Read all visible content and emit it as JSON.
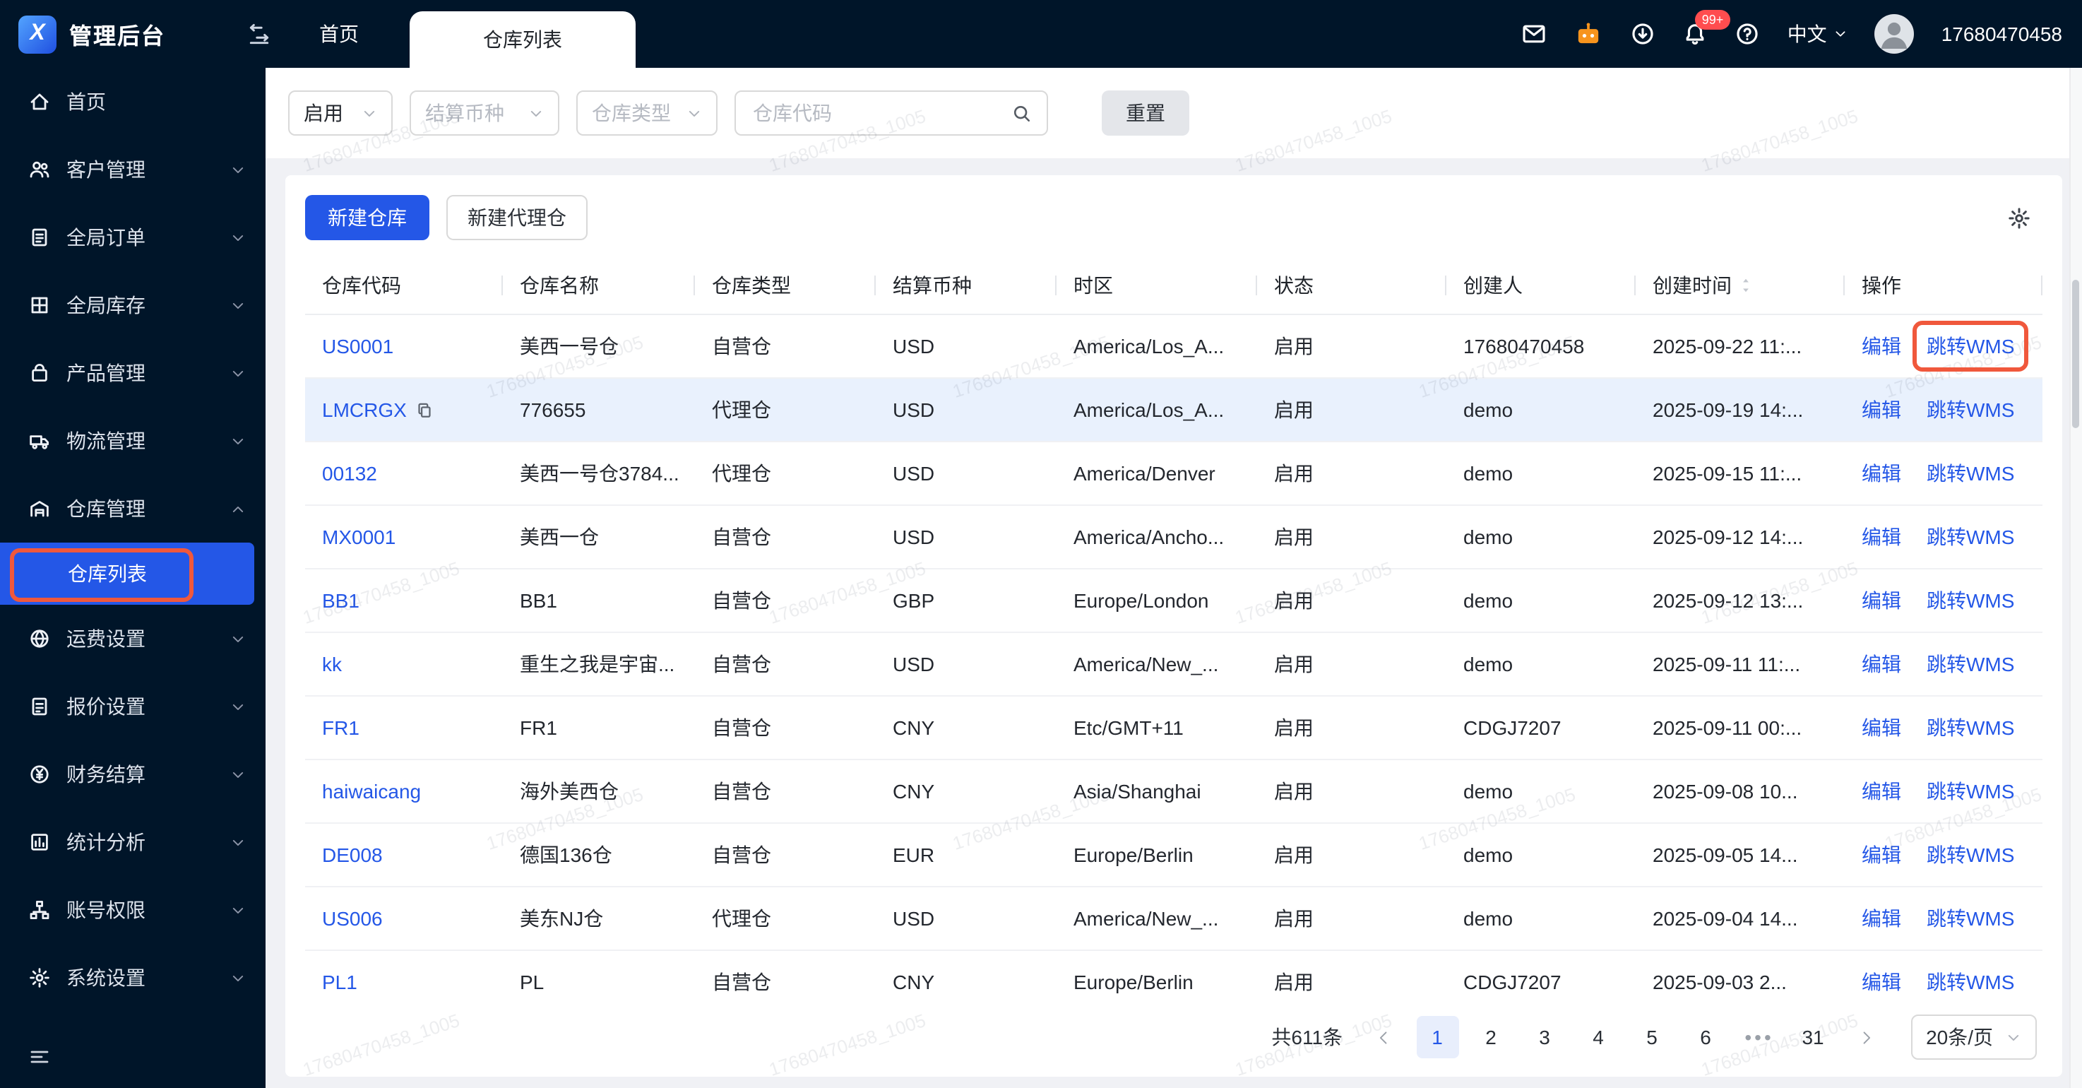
{
  "topbar": {
    "brand": "管理后台",
    "tabs": [
      {
        "key": "home",
        "label": "首页",
        "active": false
      },
      {
        "key": "warehouse-list",
        "label": "仓库列表",
        "active": true
      }
    ],
    "notification_badge": "99+",
    "language": "中文",
    "username": "17680470458"
  },
  "sidebar": {
    "items": [
      {
        "key": "home",
        "label": "首页",
        "icon": "home-icon"
      },
      {
        "key": "customer-management",
        "label": "客户管理",
        "icon": "customers-icon",
        "expandable": true
      },
      {
        "key": "global-orders",
        "label": "全局订单",
        "icon": "orders-icon",
        "expandable": true
      },
      {
        "key": "global-inventory",
        "label": "全局库存",
        "icon": "inventory-icon",
        "expandable": true
      },
      {
        "key": "product-management",
        "label": "产品管理",
        "icon": "product-icon",
        "expandable": true
      },
      {
        "key": "logistics-management",
        "label": "物流管理",
        "icon": "logistics-icon",
        "expandable": true
      },
      {
        "key": "warehouse-management",
        "label": "仓库管理",
        "icon": "warehouse-icon",
        "expandable": true,
        "expanded": true,
        "children": [
          {
            "key": "warehouse-list",
            "label": "仓库列表",
            "active": true,
            "annotated": true
          }
        ]
      },
      {
        "key": "freight-settings",
        "label": "运费设置",
        "icon": "freight-icon",
        "expandable": true
      },
      {
        "key": "quote-settings",
        "label": "报价设置",
        "icon": "quote-icon",
        "expandable": true
      },
      {
        "key": "finance-settlement",
        "label": "财务结算",
        "icon": "finance-icon",
        "expandable": true
      },
      {
        "key": "statistics-analysis",
        "label": "统计分析",
        "icon": "stats-icon",
        "expandable": true
      },
      {
        "key": "account-permissions",
        "label": "账号权限",
        "icon": "account-icon",
        "expandable": true
      },
      {
        "key": "system-settings",
        "label": "系统设置",
        "icon": "system-icon",
        "expandable": true
      }
    ]
  },
  "filters": {
    "status_value": "启用",
    "currency_placeholder": "结算币种",
    "type_placeholder": "仓库类型",
    "code_placeholder": "仓库代码",
    "reset_label": "重置"
  },
  "toolbar": {
    "new_warehouse_label": "新建仓库",
    "new_agent_warehouse_label": "新建代理仓"
  },
  "table": {
    "columns": [
      "仓库代码",
      "仓库名称",
      "仓库类型",
      "结算币种",
      "时区",
      "状态",
      "创建人",
      "创建时间",
      "操作"
    ],
    "action_labels": {
      "edit": "编辑",
      "jump_wms": "跳转WMS"
    },
    "rows": [
      {
        "code": "US0001",
        "name": "美西一号仓",
        "type": "自营仓",
        "currency": "USD",
        "tz": "America/Los_A...",
        "status": "启用",
        "creator": "17680470458",
        "created": "2025-09-22 11:...",
        "annotated": true
      },
      {
        "code": "LMCRGX",
        "copyable": true,
        "name": "776655",
        "type": "代理仓",
        "currency": "USD",
        "tz": "America/Los_A...",
        "status": "启用",
        "creator": "demo",
        "created": "2025-09-19 14:...",
        "highlight": true
      },
      {
        "code": "00132",
        "name": "美西一号仓3784...",
        "type": "代理仓",
        "currency": "USD",
        "tz": "America/Denver",
        "status": "启用",
        "creator": "demo",
        "created": "2025-09-15 11:..."
      },
      {
        "code": "MX0001",
        "name": "美西一仓",
        "type": "自营仓",
        "currency": "USD",
        "tz": "America/Ancho...",
        "status": "启用",
        "creator": "demo",
        "created": "2025-09-12 14:..."
      },
      {
        "code": "BB1",
        "name": "BB1",
        "type": "自营仓",
        "currency": "GBP",
        "tz": "Europe/London",
        "status": "启用",
        "creator": "demo",
        "created": "2025-09-12 13:..."
      },
      {
        "code": "kk",
        "name": "重生之我是宇宙...",
        "type": "自营仓",
        "currency": "USD",
        "tz": "America/New_...",
        "status": "启用",
        "creator": "demo",
        "created": "2025-09-11 11:..."
      },
      {
        "code": "FR1",
        "name": "FR1",
        "type": "自营仓",
        "currency": "CNY",
        "tz": "Etc/GMT+11",
        "status": "启用",
        "creator": "CDGJ7207",
        "created": "2025-09-11 00:..."
      },
      {
        "code": "haiwaicang",
        "name": "海外美西仓",
        "type": "自营仓",
        "currency": "CNY",
        "tz": "Asia/Shanghai",
        "status": "启用",
        "creator": "demo",
        "created": "2025-09-08 10..."
      },
      {
        "code": "DE008",
        "name": "德国136仓",
        "type": "自营仓",
        "currency": "EUR",
        "tz": "Europe/Berlin",
        "status": "启用",
        "creator": "demo",
        "created": "2025-09-05 14..."
      },
      {
        "code": "US006",
        "name": "美东NJ仓",
        "type": "代理仓",
        "currency": "USD",
        "tz": "America/New_...",
        "status": "启用",
        "creator": "demo",
        "created": "2025-09-04 14..."
      },
      {
        "code": "PL1",
        "name": "PL",
        "type": "自营仓",
        "currency": "CNY",
        "tz": "Europe/Berlin",
        "status": "启用",
        "creator": "CDGJ7207",
        "created": "2025-09-03 2..."
      }
    ]
  },
  "pagination": {
    "total_label": "共611条",
    "pages": [
      "1",
      "2",
      "3",
      "4",
      "5",
      "6",
      "•••",
      "31"
    ],
    "active_page": "1",
    "page_size_label": "20条/页"
  },
  "watermark_text": "17680470458_1005",
  "colors": {
    "accent": "#2457e7",
    "annotation": "#f0583c",
    "badge": "#ff4d4f",
    "row_highlight": "#e9f1fd",
    "dark_bg": "#001529"
  }
}
